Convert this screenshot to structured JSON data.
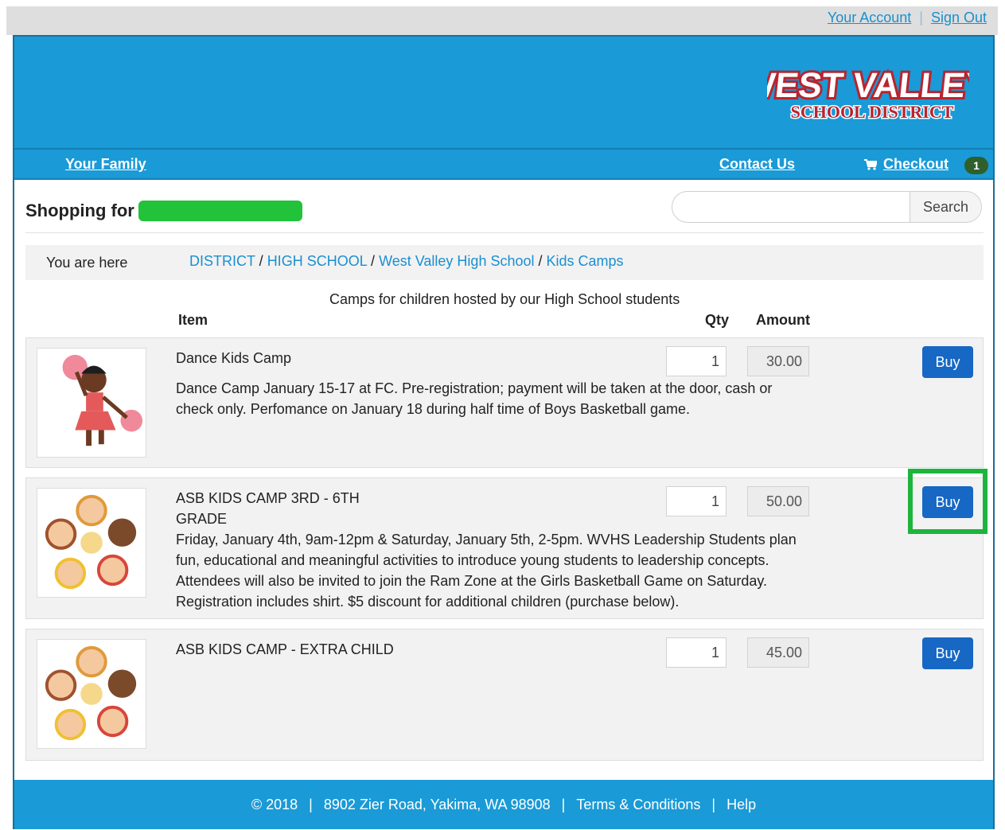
{
  "top_links": {
    "account": "Your Account",
    "separator": "|",
    "sign_out": "Sign Out"
  },
  "logo": {
    "line1": "WEST VALLEY",
    "line2": "SCHOOL DISTRICT"
  },
  "nav": {
    "family": "Your Family",
    "contact": "Contact Us",
    "checkout": "Checkout",
    "cart_count": "1"
  },
  "page": {
    "shopping_for": "Shopping for"
  },
  "search": {
    "placeholder": "",
    "button": "Search"
  },
  "breadcrumb": {
    "label": "You are here",
    "items": [
      "DISTRICT",
      "HIGH SCHOOL",
      "West Valley High School",
      "Kids Camps"
    ],
    "separator": " / "
  },
  "catalog": {
    "caption": "Camps for children hosted by our High School students",
    "col_item": "Item",
    "col_qty": "Qty",
    "col_amount": "Amount",
    "items": [
      {
        "name": "Dance Kids Camp",
        "desc_lines": [
          "Dance Camp January 15-17 at FC. Pre-registration; payment will be taken at the door, cash or",
          "check only. Perfomance on January 18 during half time of Boys Basketball game."
        ],
        "qty": "1",
        "amount": "30.00",
        "buy": "Buy"
      },
      {
        "name": "ASB KIDS CAMP 3RD - 6TH GRADE",
        "desc_lines": [
          "Friday, January 4th, 9am-12pm & Saturday, January 5th, 2-5pm. WVHS Leadership Students plan",
          "fun, educational and meaningful activities to introduce young students to leadership concepts.",
          "Attendees will also be invited to join the Ram Zone at the Girls Basketball Game on Saturday.",
          "Registration includes shirt. $5 discount for additional children (purchase below)."
        ],
        "qty": "1",
        "amount": "50.00",
        "buy": "Buy"
      },
      {
        "name": "ASB KIDS CAMP - EXTRA CHILD",
        "desc_lines": [],
        "qty": "1",
        "amount": "45.00",
        "buy": "Buy"
      }
    ]
  },
  "footer": {
    "copyright": "© 2018",
    "address": "8902 Zier Road, Yakima, WA 98908",
    "terms": "Terms & Conditions",
    "help": "Help",
    "separator": "|"
  },
  "colors": {
    "header_blue": "#1a9ad6",
    "link_blue": "#1a8fd0",
    "buy_blue": "#1767c4",
    "highlight_green": "#1db43e"
  }
}
